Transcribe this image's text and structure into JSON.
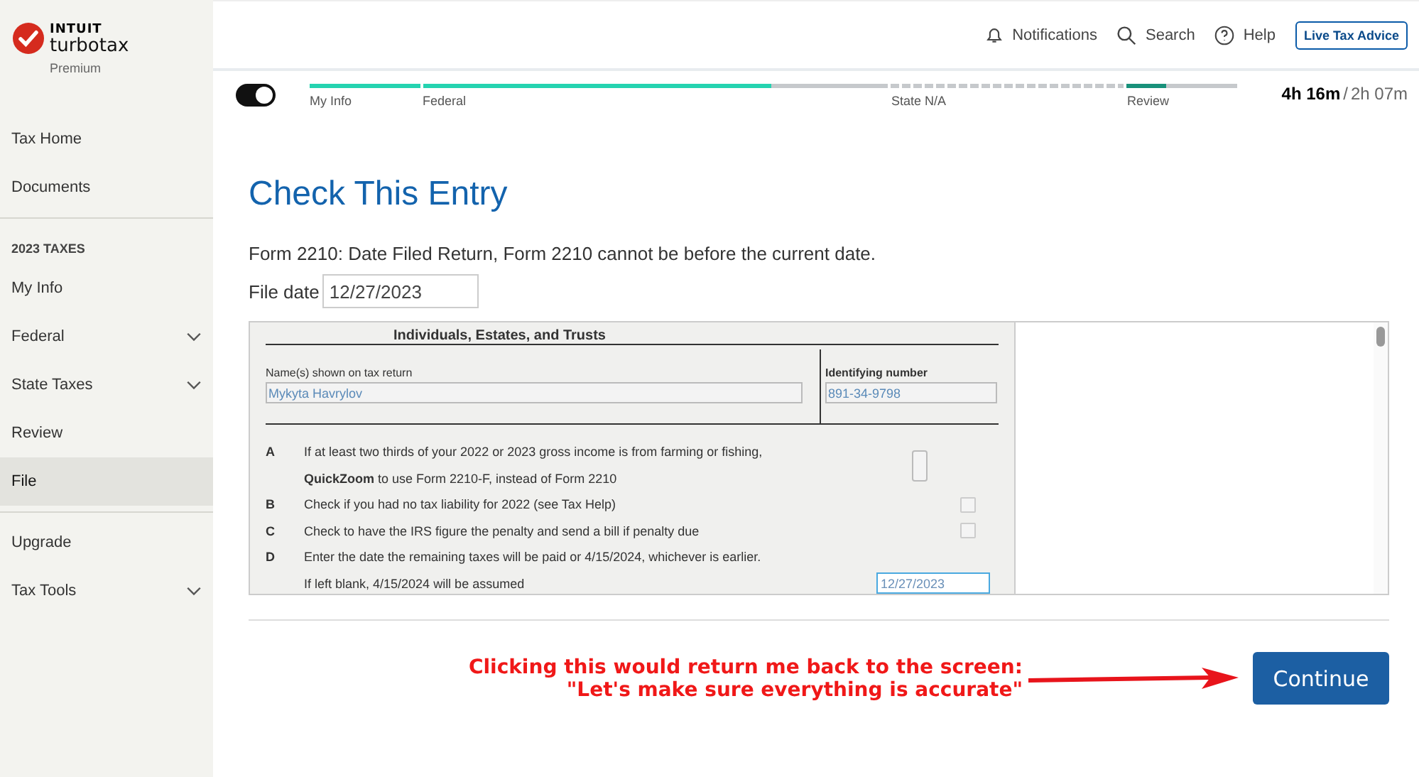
{
  "brand": {
    "company": "INTUIT",
    "product": "turbotax",
    "edition": "Premium"
  },
  "sidebar": {
    "items": [
      {
        "kind": "link",
        "label": "Tax Home",
        "selected": false
      },
      {
        "kind": "link",
        "label": "Documents",
        "selected": false
      },
      {
        "kind": "divider"
      },
      {
        "kind": "heading",
        "label": "2023 TAXES"
      },
      {
        "kind": "link",
        "label": "My Info",
        "selected": false
      },
      {
        "kind": "expandable",
        "label": "Federal",
        "selected": false,
        "expanded": false
      },
      {
        "kind": "expandable",
        "label": "State Taxes",
        "selected": false,
        "expanded": false
      },
      {
        "kind": "link",
        "label": "Review",
        "selected": false
      },
      {
        "kind": "link",
        "label": "File",
        "selected": true
      },
      {
        "kind": "divider"
      },
      {
        "kind": "link",
        "label": "Upgrade",
        "selected": false
      },
      {
        "kind": "expandable",
        "label": "Tax Tools",
        "selected": false,
        "expanded": false
      }
    ]
  },
  "header": {
    "notifications": "Notifications",
    "search": "Search",
    "help": "Help",
    "live_advice": "Live Tax Advice"
  },
  "progress": {
    "toggle_on": true,
    "steps": [
      {
        "label": "My Info",
        "kind": "solid",
        "level": 1
      },
      {
        "label": "Federal",
        "kind": "solid",
        "level": 0.75
      },
      {
        "label": "State N/A",
        "kind": "dashed"
      },
      {
        "label": "Review",
        "kind": "solid",
        "level": 0.35
      }
    ],
    "time_used": "4h 16m",
    "time_separator": "/",
    "time_estimate": "2h 07m"
  },
  "page": {
    "title": "Check This Entry",
    "message": "Form 2210: Date Filed Return, Form 2210 cannot be before the current date.",
    "file_date_label": "File date",
    "file_date_value": "12/27/2023"
  },
  "form": {
    "cut_heading": "Individuals, Estates, and Trusts",
    "name_label": "Name(s) shown on tax return",
    "name_value": "Mykyta Havrylov",
    "id_label": "Identifying number",
    "id_value": "891-34-9798",
    "lines": [
      {
        "letter": "A",
        "text": "If at least two thirds of your 2022 or 2023 gross income is from farming or fishing,",
        "kind": "button"
      },
      {
        "text": "**QuickZoom** to use Form 2210-F, instead of Form 2210",
        "kind": "plain"
      },
      {
        "letter": "B",
        "text": "Check if you had no tax liability for 2022 (see Tax Help)",
        "kind": "checkbox",
        "checked": false
      },
      {
        "letter": "C",
        "text": "Check to have the IRS figure the penalty and send a bill if penalty due",
        "kind": "checkbox",
        "checked": false
      },
      {
        "letter": "D",
        "text": "Enter the date the remaining taxes will be paid or 4/15/2024, whichever is earlier.",
        "kind": "plain"
      },
      {
        "text": "If left blank, 4/15/2024 will be assumed",
        "kind": "date",
        "value": "12/27/2023"
      }
    ]
  },
  "annotation": {
    "lines": [
      "Clicking this would return me back to the screen:",
      "\"Let's make sure everything is accurate\""
    ]
  },
  "continue_button": "Continue"
}
